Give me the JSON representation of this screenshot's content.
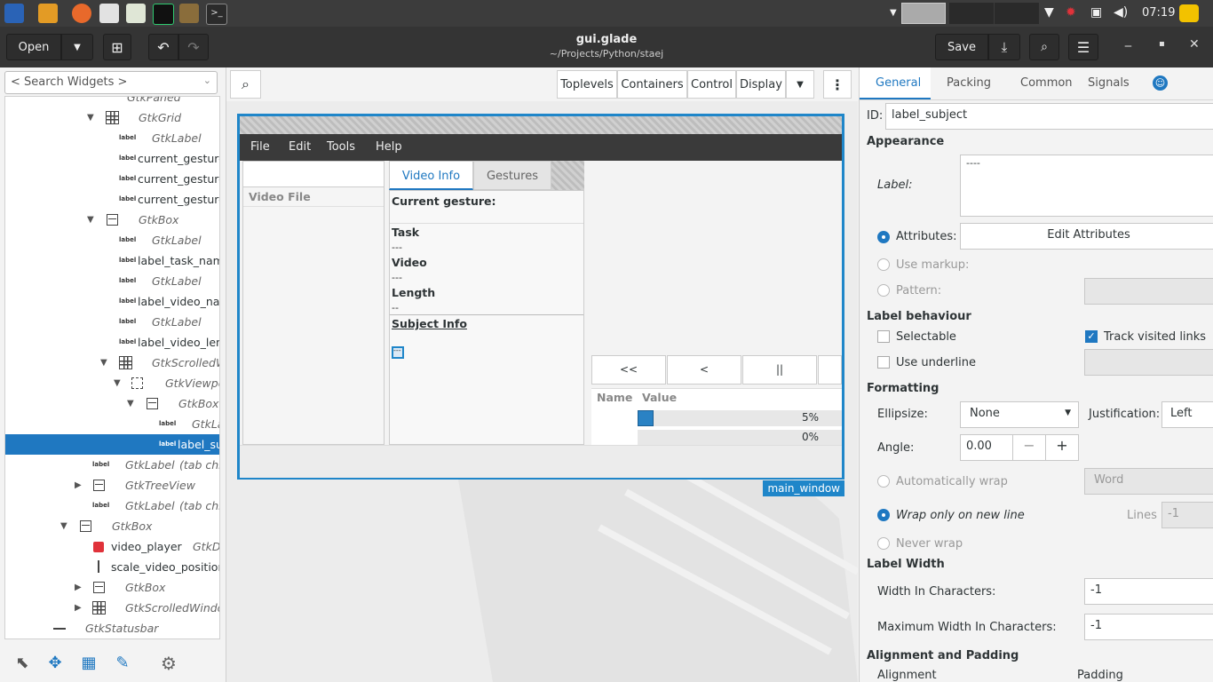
{
  "taskbar": {
    "clock": "07:19"
  },
  "header": {
    "open_label": "Open",
    "title": "gui.glade",
    "subtitle": "~/Projects/Python/staej",
    "save_label": "Save"
  },
  "left": {
    "search_placeholder": "< Search Widgets >",
    "tree": [
      {
        "label": "GtkPaned"
      },
      {
        "label": "GtkGrid"
      },
      {
        "label": "GtkLabel"
      },
      {
        "label": "current_gesture"
      },
      {
        "label": "current_gesture"
      },
      {
        "label": "current_gesture"
      },
      {
        "label": "GtkBox"
      },
      {
        "label": "GtkLabel"
      },
      {
        "label": "label_task_nam"
      },
      {
        "label": "GtkLabel"
      },
      {
        "label": "label_video_nar"
      },
      {
        "label": "GtkLabel"
      },
      {
        "label": "label_video_len"
      },
      {
        "label": "GtkScrolledW"
      },
      {
        "label": "GtkViewpo"
      },
      {
        "label": "GtkBox"
      },
      {
        "label": "GtkLa"
      },
      {
        "label": "label_su"
      },
      {
        "label": "GtkLabel",
        "suffix": "(tab chilc"
      },
      {
        "label": "GtkTreeView"
      },
      {
        "label": "GtkLabel",
        "suffix": "(tab chilc"
      },
      {
        "label": "GtkBox"
      },
      {
        "label": "video_player",
        "suffix": "GtkD"
      },
      {
        "label": "scale_video_position"
      },
      {
        "label": "GtkBox"
      },
      {
        "label": "GtkScrolledWindow"
      },
      {
        "label": "GtkStatusbar"
      }
    ]
  },
  "center": {
    "toolbar": [
      "Toplevels",
      "Containers",
      "Control",
      "Display"
    ],
    "window_label": "main_window",
    "preview": {
      "menus": [
        "File",
        "Edit",
        "Tools",
        "Help"
      ],
      "video_file_header": "Video File",
      "tabs": [
        "Video Info",
        "Gestures"
      ],
      "current_gesture": "Current gesture:",
      "task": "Task",
      "task_val": "---",
      "video": "Video",
      "video_val": "---",
      "length": "Length",
      "length_val": "--",
      "subject_info": "Subject Info",
      "subject_val": "---",
      "controls": [
        "<<",
        "<",
        "||"
      ],
      "col_name": "Name",
      "col_value": "Value",
      "progress": [
        {
          "label": "5%",
          "fraction": 0.05
        },
        {
          "label": "0%",
          "fraction": 0.0
        }
      ]
    }
  },
  "right": {
    "tabs": [
      "General",
      "Packing",
      "Common",
      "Signals"
    ],
    "id_label": "ID:",
    "id_value": "label_subject",
    "appearance": "Appearance",
    "label_label": "Label:",
    "label_value": "----",
    "attributes": "Attributes:",
    "edit_attributes": "Edit Attributes",
    "use_markup": "Use markup:",
    "pattern": "Pattern:",
    "label_behaviour": "Label behaviour",
    "selectable": "Selectable",
    "track_visited": "Track visited links",
    "use_underline": "Use underline",
    "formatting": "Formatting",
    "ellipsize": "Ellipsize:",
    "ellipsize_value": "None",
    "justification": "Justification:",
    "justification_value": "Left",
    "angle": "Angle:",
    "angle_value": "0.00",
    "auto_wrap": "Automatically wrap",
    "wrap_mode": "Word",
    "wrap_new_line": "Wrap only on new line",
    "lines": "Lines",
    "lines_value": "-1",
    "never_wrap": "Never wrap",
    "label_width": "Label Width",
    "width_chars": "Width In Characters:",
    "width_chars_value": "-1",
    "max_width_chars": "Maximum Width In Characters:",
    "max_width_chars_value": "-1",
    "alignment_padding": "Alignment and Padding",
    "alignment": "Alignment",
    "padding": "Padding"
  },
  "colors": {
    "accent": "#1f78c1",
    "headerbar": "#343434",
    "taskbar": "#3c3c3c"
  }
}
